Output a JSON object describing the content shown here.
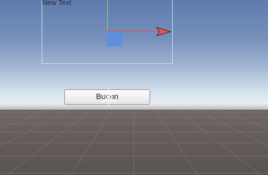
{
  "scene": {
    "text_object": {
      "label": "New Text"
    },
    "button_object": {
      "label": "Button"
    },
    "colors": {
      "sky_top": "#5e7bae",
      "sky_horizon": "#f0f4f7",
      "ground": "#625b58",
      "x_axis": "#e3564a",
      "y_axis": "#7fd45a",
      "selection_square": "#568ce6",
      "rect_outline": "#c8e6f0"
    },
    "gizmo": {
      "icons": [
        "move-x-arrow-icon",
        "y-axis-line",
        "xy-plane-handle-icon"
      ]
    }
  }
}
